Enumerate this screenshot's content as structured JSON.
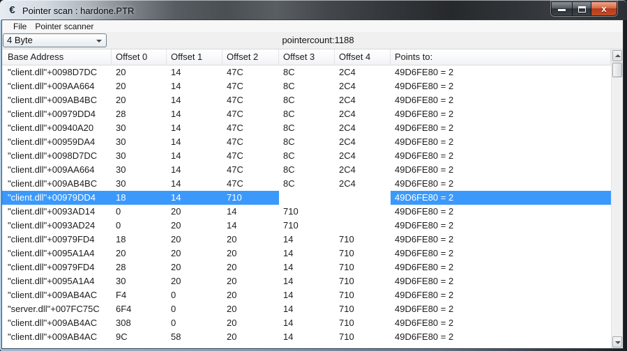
{
  "window": {
    "title": "Pointer scan : hardone.PTR",
    "app_icon": "cheat-engine-icon",
    "controls": {
      "minimize": "minimize-icon",
      "maximize": "maximize-icon",
      "close": "close-icon"
    }
  },
  "menubar": {
    "items": [
      {
        "label": "File"
      },
      {
        "label": "Pointer scanner"
      }
    ]
  },
  "toolbar": {
    "value_type": "4 Byte",
    "value_type_icon": "chevron-down-icon",
    "pointer_count": "pointercount:1188"
  },
  "table": {
    "columns": [
      "Base Address",
      "Offset 0",
      "Offset 1",
      "Offset 2",
      "Offset 3",
      "Offset 4",
      "Points to:"
    ],
    "rows": [
      {
        "base": "\"client.dll\"+0098D7DC",
        "offsets": [
          "20",
          "14",
          "47C",
          "8C",
          "2C4"
        ],
        "points_to": "49D6FE80 = 2",
        "selected": false
      },
      {
        "base": "\"client.dll\"+009AA664",
        "offsets": [
          "20",
          "14",
          "47C",
          "8C",
          "2C4"
        ],
        "points_to": "49D6FE80 = 2",
        "selected": false
      },
      {
        "base": "\"client.dll\"+009AB4BC",
        "offsets": [
          "20",
          "14",
          "47C",
          "8C",
          "2C4"
        ],
        "points_to": "49D6FE80 = 2",
        "selected": false
      },
      {
        "base": "\"client.dll\"+00979DD4",
        "offsets": [
          "28",
          "14",
          "47C",
          "8C",
          "2C4"
        ],
        "points_to": "49D6FE80 = 2",
        "selected": false
      },
      {
        "base": "\"client.dll\"+00940A20",
        "offsets": [
          "30",
          "14",
          "47C",
          "8C",
          "2C4"
        ],
        "points_to": "49D6FE80 = 2",
        "selected": false
      },
      {
        "base": "\"client.dll\"+00959DA4",
        "offsets": [
          "30",
          "14",
          "47C",
          "8C",
          "2C4"
        ],
        "points_to": "49D6FE80 = 2",
        "selected": false
      },
      {
        "base": "\"client.dll\"+0098D7DC",
        "offsets": [
          "30",
          "14",
          "47C",
          "8C",
          "2C4"
        ],
        "points_to": "49D6FE80 = 2",
        "selected": false
      },
      {
        "base": "\"client.dll\"+009AA664",
        "offsets": [
          "30",
          "14",
          "47C",
          "8C",
          "2C4"
        ],
        "points_to": "49D6FE80 = 2",
        "selected": false
      },
      {
        "base": "\"client.dll\"+009AB4BC",
        "offsets": [
          "30",
          "14",
          "47C",
          "8C",
          "2C4"
        ],
        "points_to": "49D6FE80 = 2",
        "selected": false
      },
      {
        "base": "\"client.dll\"+00979DD4",
        "offsets": [
          "18",
          "14",
          "710",
          "",
          ""
        ],
        "points_to": "49D6FE80 = 2",
        "selected": true
      },
      {
        "base": "\"client.dll\"+0093AD14",
        "offsets": [
          "0",
          "20",
          "14",
          "710",
          ""
        ],
        "points_to": "49D6FE80 = 2",
        "selected": false
      },
      {
        "base": "\"client.dll\"+0093AD24",
        "offsets": [
          "0",
          "20",
          "14",
          "710",
          ""
        ],
        "points_to": "49D6FE80 = 2",
        "selected": false
      },
      {
        "base": "\"client.dll\"+00979FD4",
        "offsets": [
          "18",
          "20",
          "20",
          "14",
          "710"
        ],
        "points_to": "49D6FE80 = 2",
        "selected": false
      },
      {
        "base": "\"client.dll\"+0095A1A4",
        "offsets": [
          "20",
          "20",
          "20",
          "14",
          "710"
        ],
        "points_to": "49D6FE80 = 2",
        "selected": false
      },
      {
        "base": "\"client.dll\"+00979FD4",
        "offsets": [
          "28",
          "20",
          "20",
          "14",
          "710"
        ],
        "points_to": "49D6FE80 = 2",
        "selected": false
      },
      {
        "base": "\"client.dll\"+0095A1A4",
        "offsets": [
          "30",
          "20",
          "20",
          "14",
          "710"
        ],
        "points_to": "49D6FE80 = 2",
        "selected": false
      },
      {
        "base": "\"client.dll\"+009AB4AC",
        "offsets": [
          "F4",
          "0",
          "20",
          "14",
          "710"
        ],
        "points_to": "49D6FE80 = 2",
        "selected": false
      },
      {
        "base": "\"server.dll\"+007FC75C",
        "offsets": [
          "6F4",
          "0",
          "20",
          "14",
          "710"
        ],
        "points_to": "49D6FE80 = 2",
        "selected": false
      },
      {
        "base": "\"client.dll\"+009AB4AC",
        "offsets": [
          "308",
          "0",
          "20",
          "14",
          "710"
        ],
        "points_to": "49D6FE80 = 2",
        "selected": false
      },
      {
        "base": "\"client.dll\"+009AB4AC",
        "offsets": [
          "9C",
          "58",
          "20",
          "14",
          "710"
        ],
        "points_to": "49D6FE80 = 2",
        "selected": false
      }
    ]
  },
  "scrollbar": {
    "up": "arrow-up-icon",
    "down": "arrow-down-icon"
  },
  "colors": {
    "selection": "#3B99FC",
    "selection_text": "#FFFFFF"
  }
}
